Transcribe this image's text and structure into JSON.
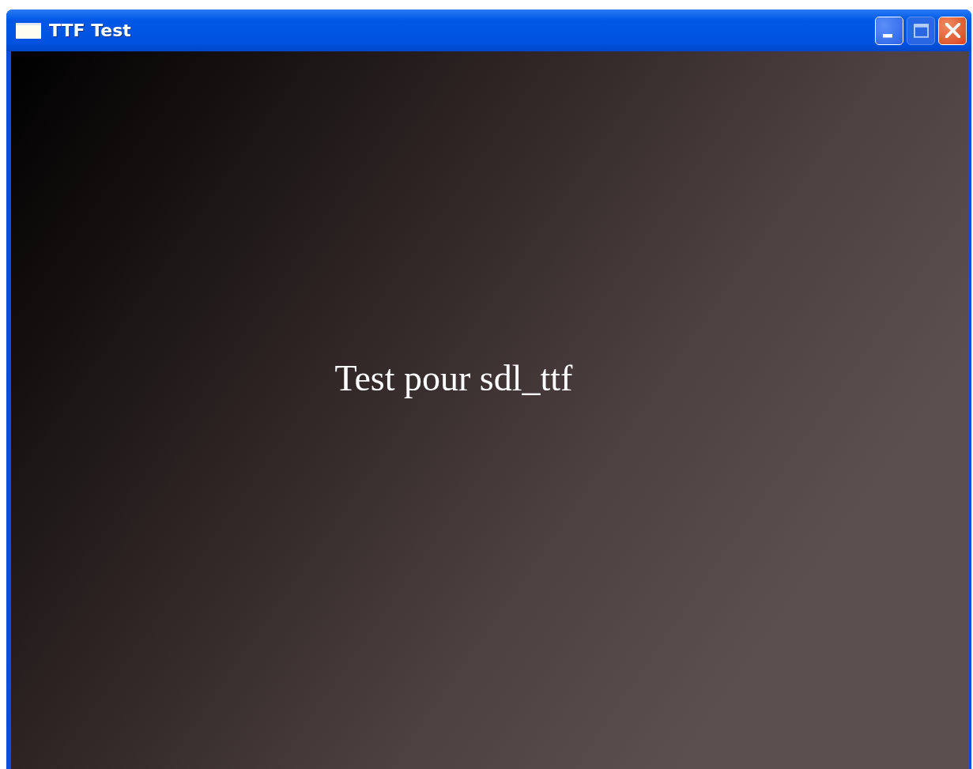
{
  "window": {
    "title": "TTF Test",
    "buttons": [
      {
        "kind": "minimize",
        "disabled": false
      },
      {
        "kind": "maximize",
        "disabled": true
      },
      {
        "kind": "close",
        "disabled": false
      }
    ]
  },
  "content": {
    "text": "Test pour sdl_ttf"
  }
}
